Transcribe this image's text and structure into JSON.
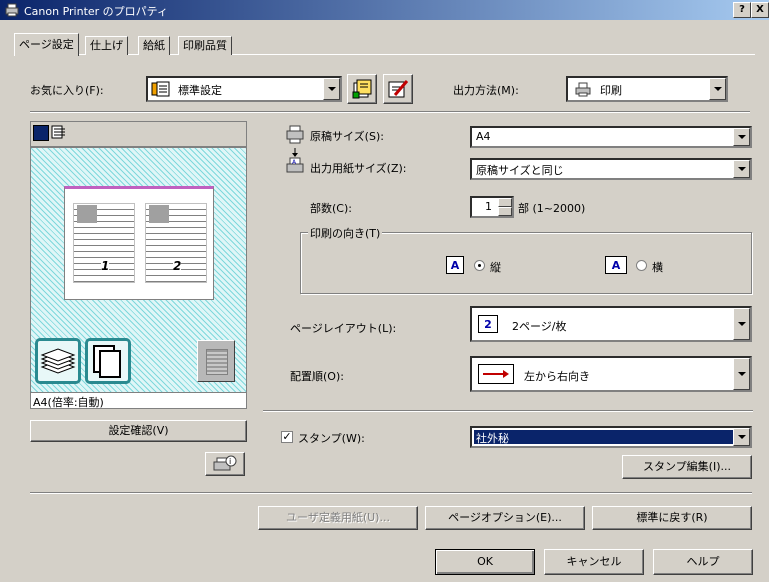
{
  "window": {
    "title": "Canon Printer のプロパティ",
    "help_btn": "?",
    "close_btn": "X"
  },
  "tabs": [
    {
      "label": "ページ設定",
      "active": true
    },
    {
      "label": "仕上げ",
      "active": false
    },
    {
      "label": "給紙",
      "active": false
    },
    {
      "label": "印刷品質",
      "active": false
    }
  ],
  "favorites": {
    "label": "お気に入り(F):",
    "value": "標準設定"
  },
  "output_method": {
    "label": "出力方法(M):",
    "value": "印刷"
  },
  "original_size": {
    "label": "原稿サイズ(S):",
    "value": "A4"
  },
  "output_paper_size": {
    "label": "出力用紙サイズ(Z):",
    "value": "原稿サイズと同じ"
  },
  "copies": {
    "label": "部数(C):",
    "value": "1",
    "unit": "部 (1~2000)"
  },
  "orientation": {
    "group_label": "印刷の向き(T)",
    "portrait": "縦",
    "landscape": "横",
    "selected": "portrait"
  },
  "page_layout": {
    "label": "ページレイアウト(L):",
    "value": "2ページ/枚",
    "icon_text": "2"
  },
  "page_order": {
    "label": "配置順(O):",
    "value": "左から右向き"
  },
  "stamp": {
    "label": "スタンプ(W):",
    "checked": true,
    "check_mark": "✓",
    "value": "社外秘",
    "edit_btn": "スタンプ編集(I)..."
  },
  "preview": {
    "caption": "A4(倍率:自動)",
    "page_numbers": [
      "1",
      "2"
    ],
    "confirm_btn": "設定確認(V)"
  },
  "buttons": {
    "custom_paper": "ユーザ定義用紙(U)...",
    "page_options": "ページオプション(E)...",
    "restore_default": "標準に戻す(R)",
    "ok": "OK",
    "cancel": "キャンセル",
    "help": "ヘルプ"
  },
  "colors": {
    "titlebar_start": "#0a246a",
    "selection": "#0a246a",
    "face": "#d4d0c8"
  }
}
